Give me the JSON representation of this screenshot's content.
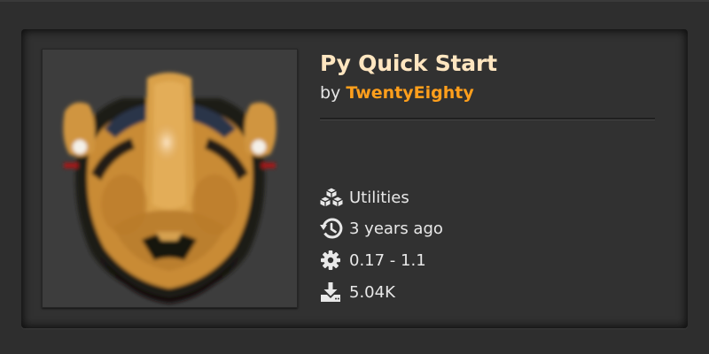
{
  "mod": {
    "title": "Py Quick Start",
    "by_prefix": "by",
    "author": "TwentyEighty",
    "thumbnail_icon": "helmet-thumbnail",
    "meta": {
      "category": "Utilities",
      "updated": "3 years ago",
      "version": "0.17 - 1.1",
      "downloads": "5.04K"
    },
    "icons": {
      "category": "cubes-icon",
      "updated": "history-icon",
      "version": "gear-icon",
      "downloads": "download-icon"
    }
  },
  "colors": {
    "title": "#ffe6c0",
    "author": "#ff9f1c",
    "card_bg": "#313131",
    "page_bg": "#2e2e2e"
  }
}
